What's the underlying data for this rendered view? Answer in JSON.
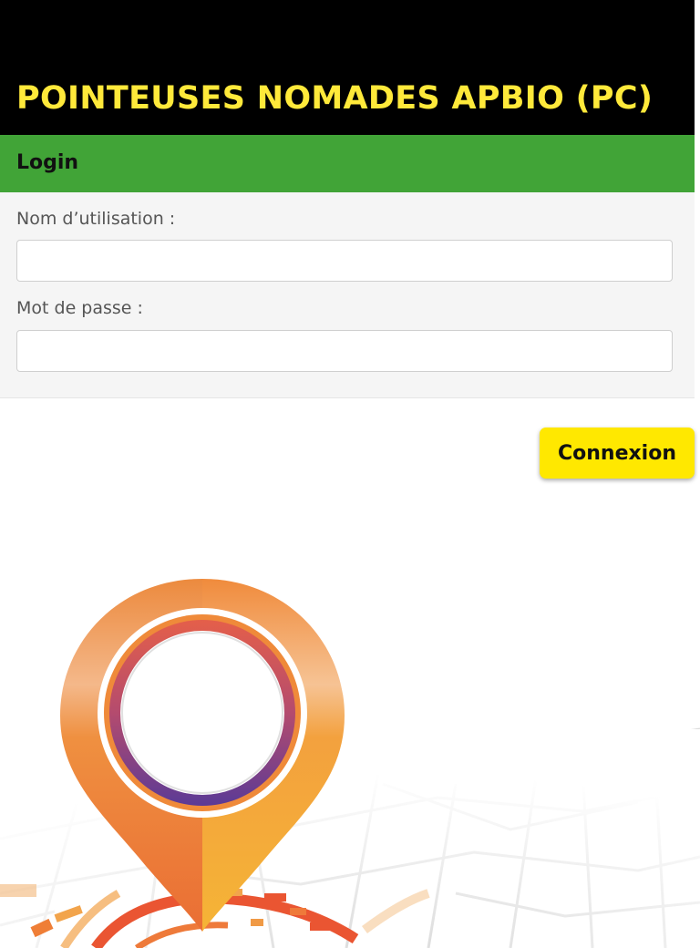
{
  "header": {
    "title": "POINTEUSES NOMADES APBIO (PC)"
  },
  "login": {
    "title": "Login",
    "username_label": "Nom d’utilisation :",
    "username_value": "",
    "password_label": "Mot de passe :",
    "password_value": "",
    "submit_label": "Connexion"
  },
  "illustration": {
    "icon": "location-pin-icon",
    "background": "city-map"
  },
  "colors": {
    "header_bg": "#000000",
    "title_text": "#ffe93a",
    "login_bar": "#41a437",
    "form_bg": "#f5f5f5",
    "button_bg": "#ffe800",
    "pin_orange": "#ef8a3a",
    "ring_purple": "#5b3a96"
  }
}
